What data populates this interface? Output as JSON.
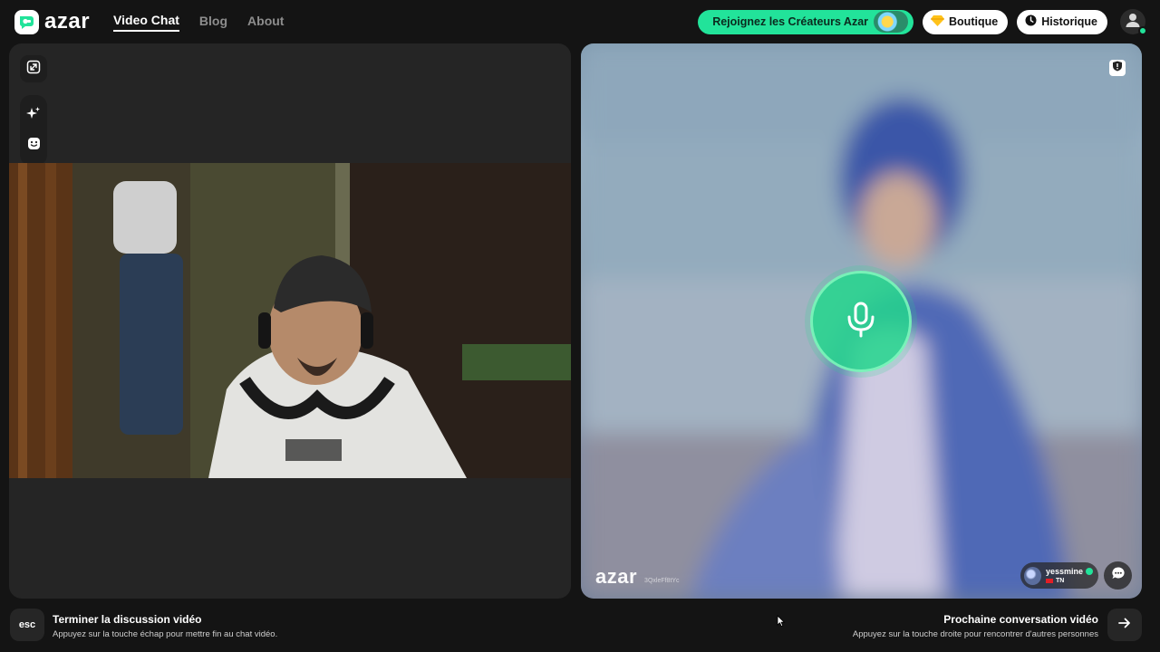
{
  "header": {
    "logo_text": "azar",
    "nav": [
      {
        "label": "Video Chat",
        "active": true
      },
      {
        "label": "Blog",
        "active": false
      },
      {
        "label": "About",
        "active": false
      }
    ],
    "creators_label": "Rejoignez les Créateurs Azar",
    "shop_label": "Boutique",
    "history_label": "Historique"
  },
  "remote": {
    "watermark": "azar",
    "watermark_id": "3QxleFf8tYc",
    "user_name": "yessmine",
    "user_country": "TN"
  },
  "footer": {
    "esc_key": "esc",
    "end_title": "Terminer la discussion vidéo",
    "end_sub": "Appuyez sur la touche échap pour mettre fin au chat vidéo.",
    "next_title": "Prochaine conversation vidéo",
    "next_sub": "Appuyez sur la touche droite pour rencontrer d'autres personnes"
  },
  "colors": {
    "accent": "#22e39a",
    "background": "#141414",
    "panel": "#252525"
  },
  "icons": [
    "expand-icon",
    "sparkle-icon",
    "sticker-icon",
    "report-icon",
    "microphone-icon",
    "chat-icon",
    "arrow-right-icon",
    "gem-icon",
    "clock-icon",
    "user-icon"
  ]
}
